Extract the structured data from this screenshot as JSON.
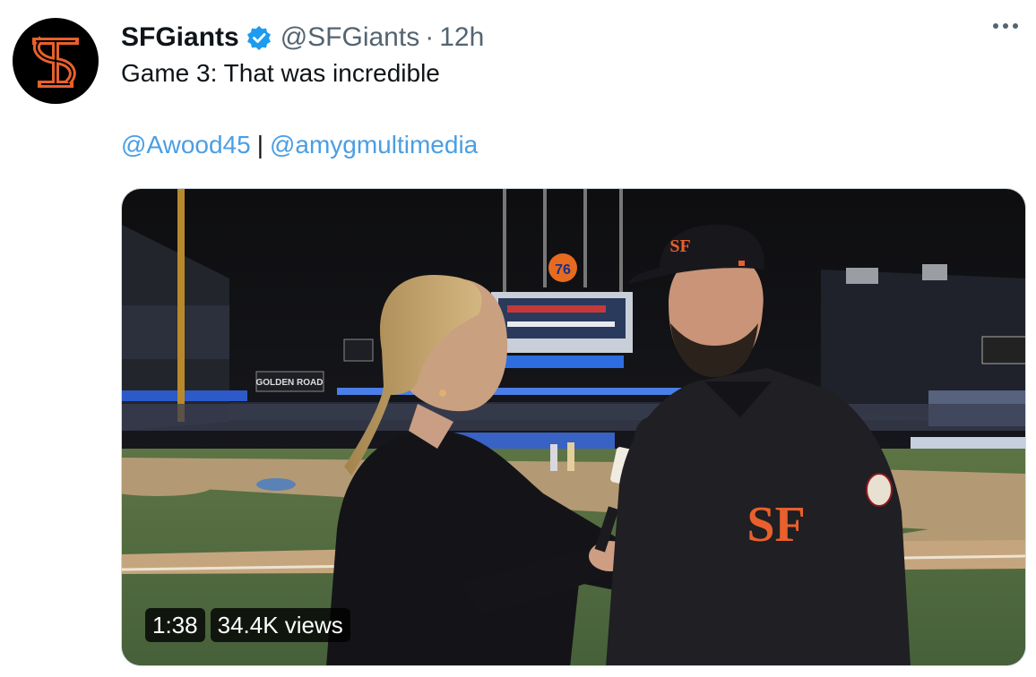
{
  "account": {
    "display_name": "SFGiants",
    "handle": "@SFGiants",
    "separator": "·",
    "time": "12h",
    "avatar_logo": "sf-giants-logo",
    "verified_icon": "verified-badge-icon"
  },
  "tweet": {
    "text": "Game 3: That was incredible",
    "mentions": [
      "@Awood45",
      "@amygmultimedia"
    ],
    "mention_separator": "|"
  },
  "video": {
    "duration": "1:38",
    "views": "34.4K views",
    "scoreboard_sign": "76",
    "billboard_text": "GOLDEN ROAD"
  },
  "colors": {
    "link": "#4a9ee4",
    "verified": "#1d9bf0",
    "giants_orange": "#e8602c"
  }
}
